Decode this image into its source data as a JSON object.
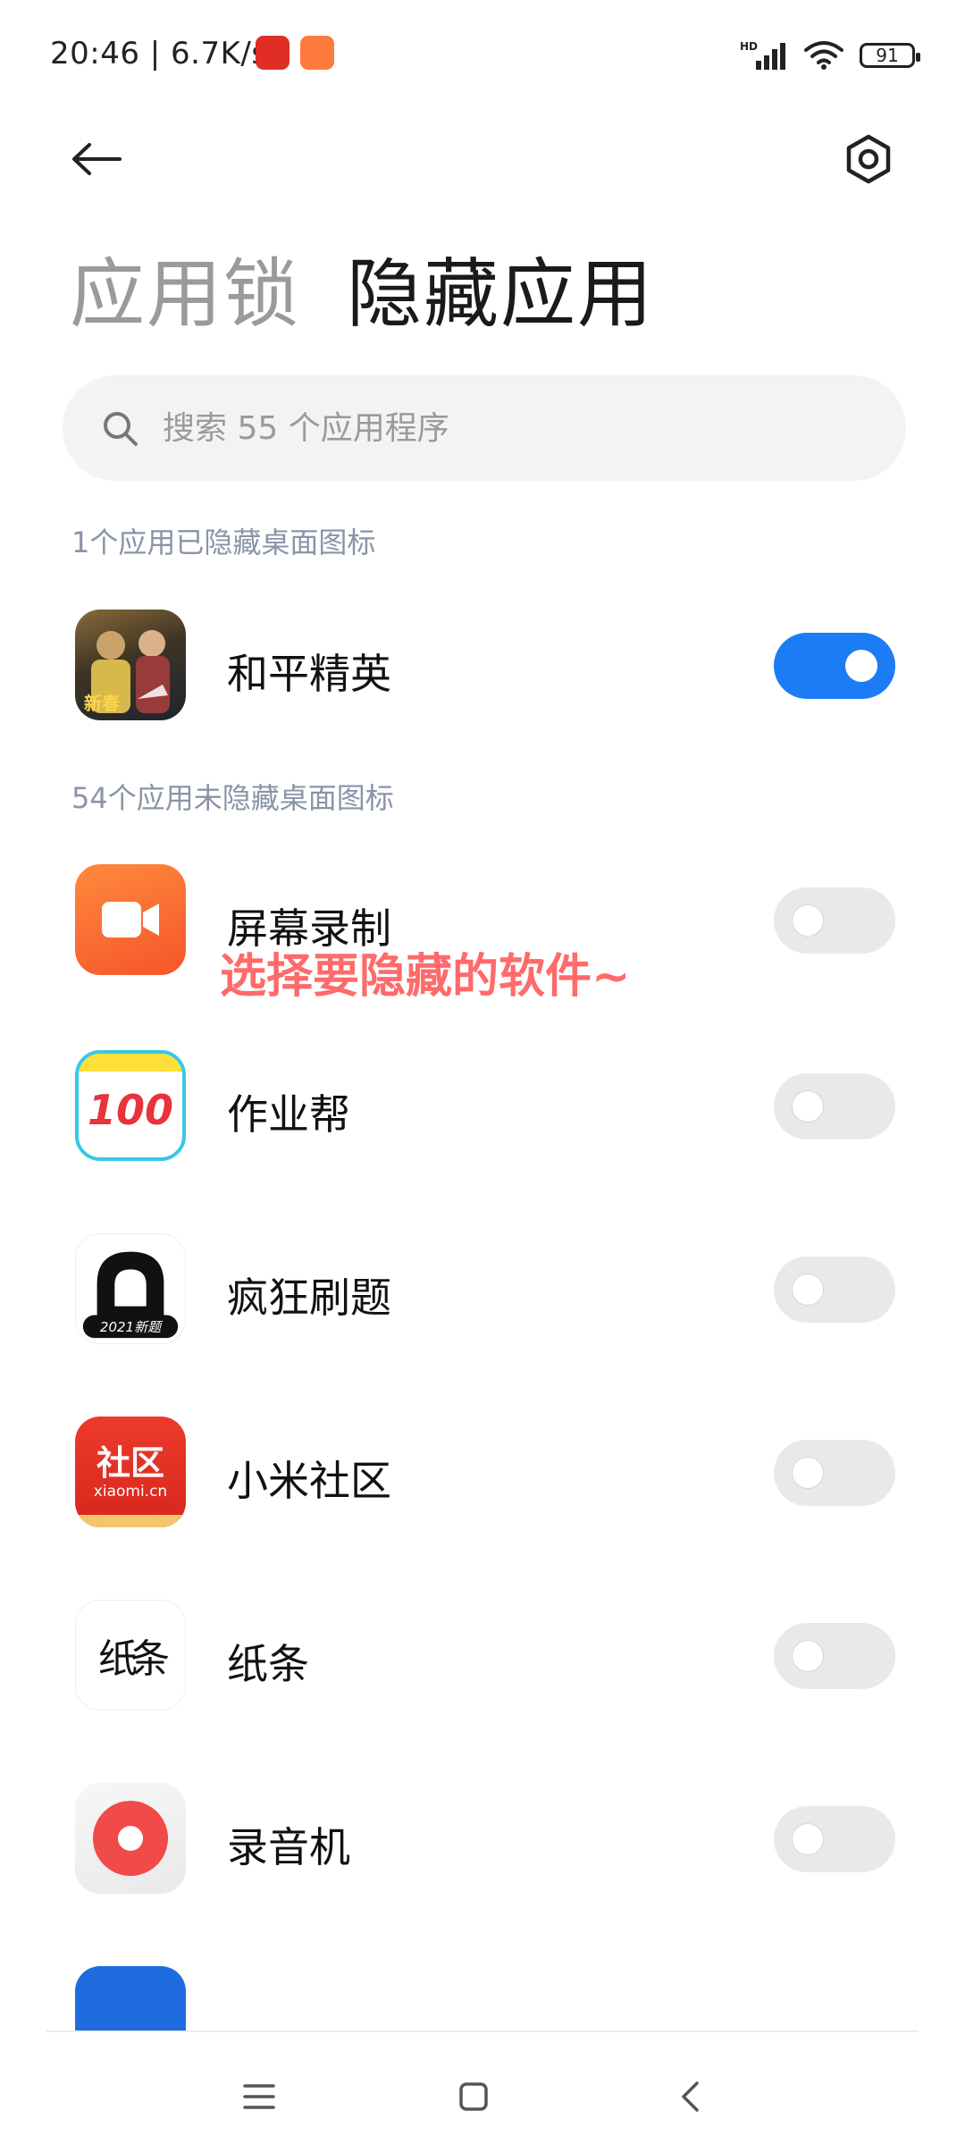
{
  "status_bar": {
    "time_speed": "20:46 | 6.7K/s",
    "network": "HD",
    "battery": "91"
  },
  "header": {
    "tabs": [
      {
        "label": "应用锁",
        "active": false
      },
      {
        "label": "隐藏应用",
        "active": true
      }
    ]
  },
  "search": {
    "placeholder": "搜索 55 个应用程序"
  },
  "sections": {
    "hidden_label": "1个应用已隐藏桌面图标",
    "not_hidden_label": "54个应用未隐藏桌面图标"
  },
  "hidden_apps": [
    {
      "name": "和平精英",
      "toggle": true,
      "icon": "peace-elite-game-icon",
      "badge": "新春"
    }
  ],
  "apps": [
    {
      "name": "屏幕录制",
      "toggle": false,
      "icon": "screen-recorder-icon"
    },
    {
      "name": "作业帮",
      "toggle": false,
      "icon": "zuoyebang-icon",
      "icon_text": "100"
    },
    {
      "name": "疯狂刷题",
      "toggle": false,
      "icon": "fengkuang-shuati-icon",
      "icon_text": "2021新题"
    },
    {
      "name": "小米社区",
      "toggle": false,
      "icon": "xiaomi-community-icon",
      "icon_text": "社区",
      "icon_subtext": "xiaomi.cn"
    },
    {
      "name": "纸条",
      "toggle": false,
      "icon": "zhitiao-icon",
      "icon_text": "纸条"
    },
    {
      "name": "录音机",
      "toggle": false,
      "icon": "voice-recorder-icon"
    }
  ],
  "overlay_caption": "选择要隐藏的软件~",
  "colors": {
    "toggle_on": "#1b7cf6",
    "toggle_off": "#e9e9e9",
    "section_label": "#8a93a8",
    "caption": "#ff6a6a"
  }
}
